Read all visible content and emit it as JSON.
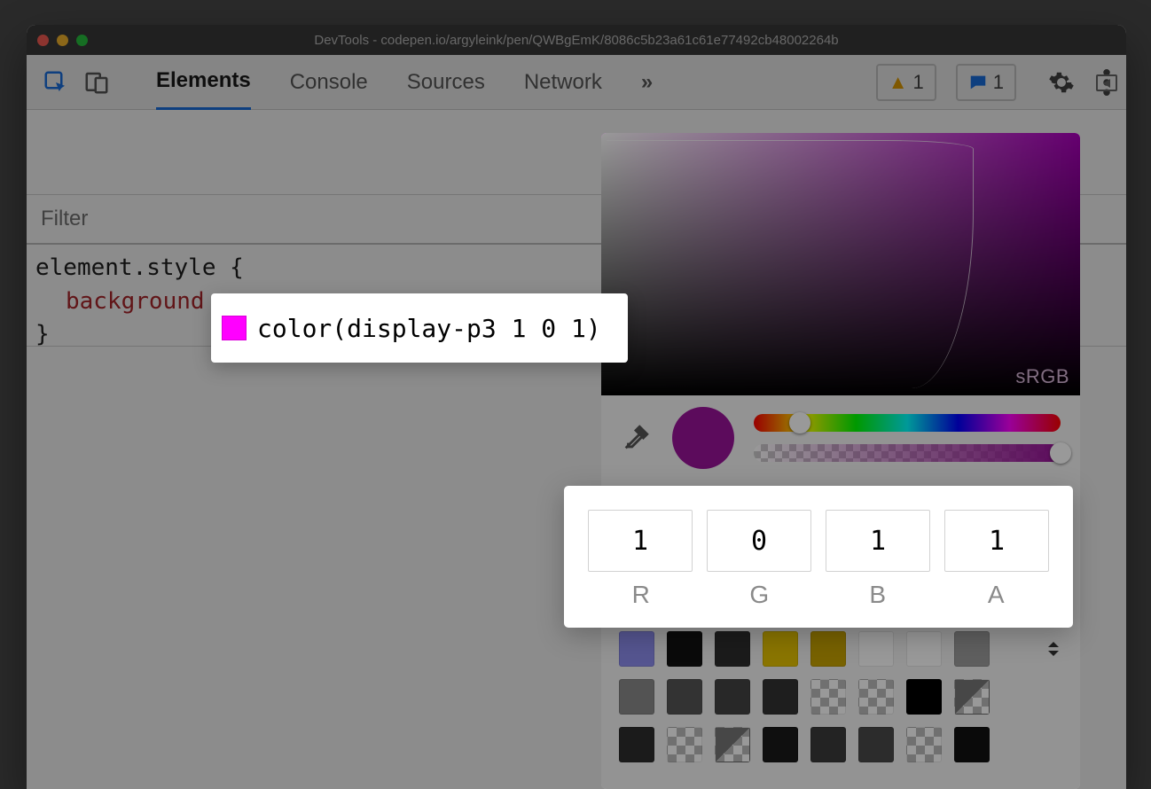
{
  "window": {
    "title": "DevTools - codepen.io/argyleink/pen/QWBgEmK/8086c5b23a61c61e77492cb48002264b"
  },
  "toolbar": {
    "tabs": [
      "Elements",
      "Console",
      "Sources",
      "Network"
    ],
    "active_tab_index": 0,
    "overflow_glyph": "»",
    "warnings_count": "1",
    "messages_count": "1"
  },
  "filter": {
    "placeholder": "Filter"
  },
  "styles": {
    "selector_open": "element.style {",
    "prop_name": "background",
    "selector_close": "}"
  },
  "value_popover": {
    "swatch_color": "#ff00ff",
    "text": "color(display-p3 1 0 1)"
  },
  "picker": {
    "gamut_label": "sRGB",
    "current_color": "#9a139a",
    "hue_thumb_pct": 15,
    "alpha_thumb_pct": 100
  },
  "rgba": {
    "r": "1",
    "g": "0",
    "b": "1",
    "a": "1",
    "labels": {
      "r": "R",
      "g": "G",
      "b": "B",
      "a": "A"
    }
  },
  "palette": {
    "rows": [
      [
        "#8e8ef1",
        "#111",
        "#2d2d2d",
        "#e6c300",
        "#c9a300",
        "#ffffff",
        "#ffffff",
        "#9e9e9e"
      ],
      [
        "#8a8a8a",
        "#555",
        "#444",
        "#333",
        "checker",
        "checker",
        "#000",
        "half"
      ],
      [
        "#2e2e2e",
        "checker",
        "half",
        "#1a1a1a",
        "#3b3b3b",
        "#4a4a4a",
        "checker",
        "#111"
      ]
    ]
  }
}
